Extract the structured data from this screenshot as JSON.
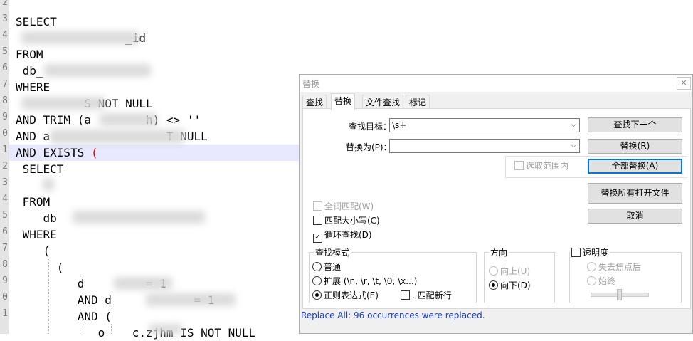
{
  "editor": {
    "lines": [
      {
        "text": "SELECT",
        "indent": 0
      },
      {
        "text": "                _id",
        "indent": 0
      },
      {
        "text": "FROM",
        "indent": 0
      },
      {
        "text": " db_",
        "indent": 0
      },
      {
        "text": "WHERE",
        "indent": 0
      },
      {
        "text": "          S NOT NULL",
        "indent": 0
      },
      {
        "text": "AND TRIM (a        h) <> ''",
        "indent": 0
      },
      {
        "text": "AND a                 T NULL",
        "indent": 0
      },
      {
        "text": "AND EXISTS (",
        "indent": 0
      },
      {
        "text": " SELECT",
        "indent": 0
      },
      {
        "text": "",
        "indent": 0
      },
      {
        "text": " FROM",
        "indent": 0
      },
      {
        "text": "    db",
        "indent": 0
      },
      {
        "text": " WHERE",
        "indent": 0
      },
      {
        "text": "    (",
        "indent": 0
      },
      {
        "text": "      (",
        "indent": 0
      },
      {
        "text": "         d         = 1",
        "indent": 0
      },
      {
        "text": "         AND d            = 1",
        "indent": 0
      },
      {
        "text": "         AND (",
        "indent": 0
      },
      {
        "text": "            o    c.zjhm IS NOT NULL",
        "indent": 0
      }
    ],
    "line_numbers": [
      "2",
      "3",
      "4",
      "5",
      "6",
      "7",
      "8",
      "9",
      "0",
      "1",
      "2",
      "3",
      "4",
      "5",
      "6",
      "7",
      "8",
      "9",
      "0",
      "1"
    ]
  },
  "dialog": {
    "title": "替换",
    "close": "✕",
    "tabs": [
      "查找",
      "替换",
      "文件查找",
      "标记"
    ],
    "active_tab": "替换",
    "find_label": "查找目标：",
    "find_value": "\\s+",
    "replace_label": "替换为(P)：",
    "replace_value": "",
    "in_selection": "选取范围内",
    "buttons": {
      "find_next": "查找下一个",
      "replace": "替换(R)",
      "replace_all": "全部替换(A)",
      "replace_all_open": "替换所有打开文件",
      "cancel": "取消"
    },
    "options": {
      "whole_word": "全词匹配(W)",
      "match_case": "匹配大小写(C)",
      "wrap_around": "循环查找(D)"
    },
    "search_mode": {
      "title": "查找模式",
      "normal": "普通",
      "extended": "扩展 (\\n, \\r, \\t, \\0, \\x...)",
      "regex": "正则表达式(E)",
      "dot_newline": ". 匹配新行"
    },
    "direction": {
      "title": "方向",
      "up": "向上(U)",
      "down": "向下(D)"
    },
    "transparency": {
      "title": "透明度",
      "on_lose_focus": "失去焦点后",
      "always": "始终"
    },
    "status": "Replace All: 96 occurrences were replaced."
  }
}
